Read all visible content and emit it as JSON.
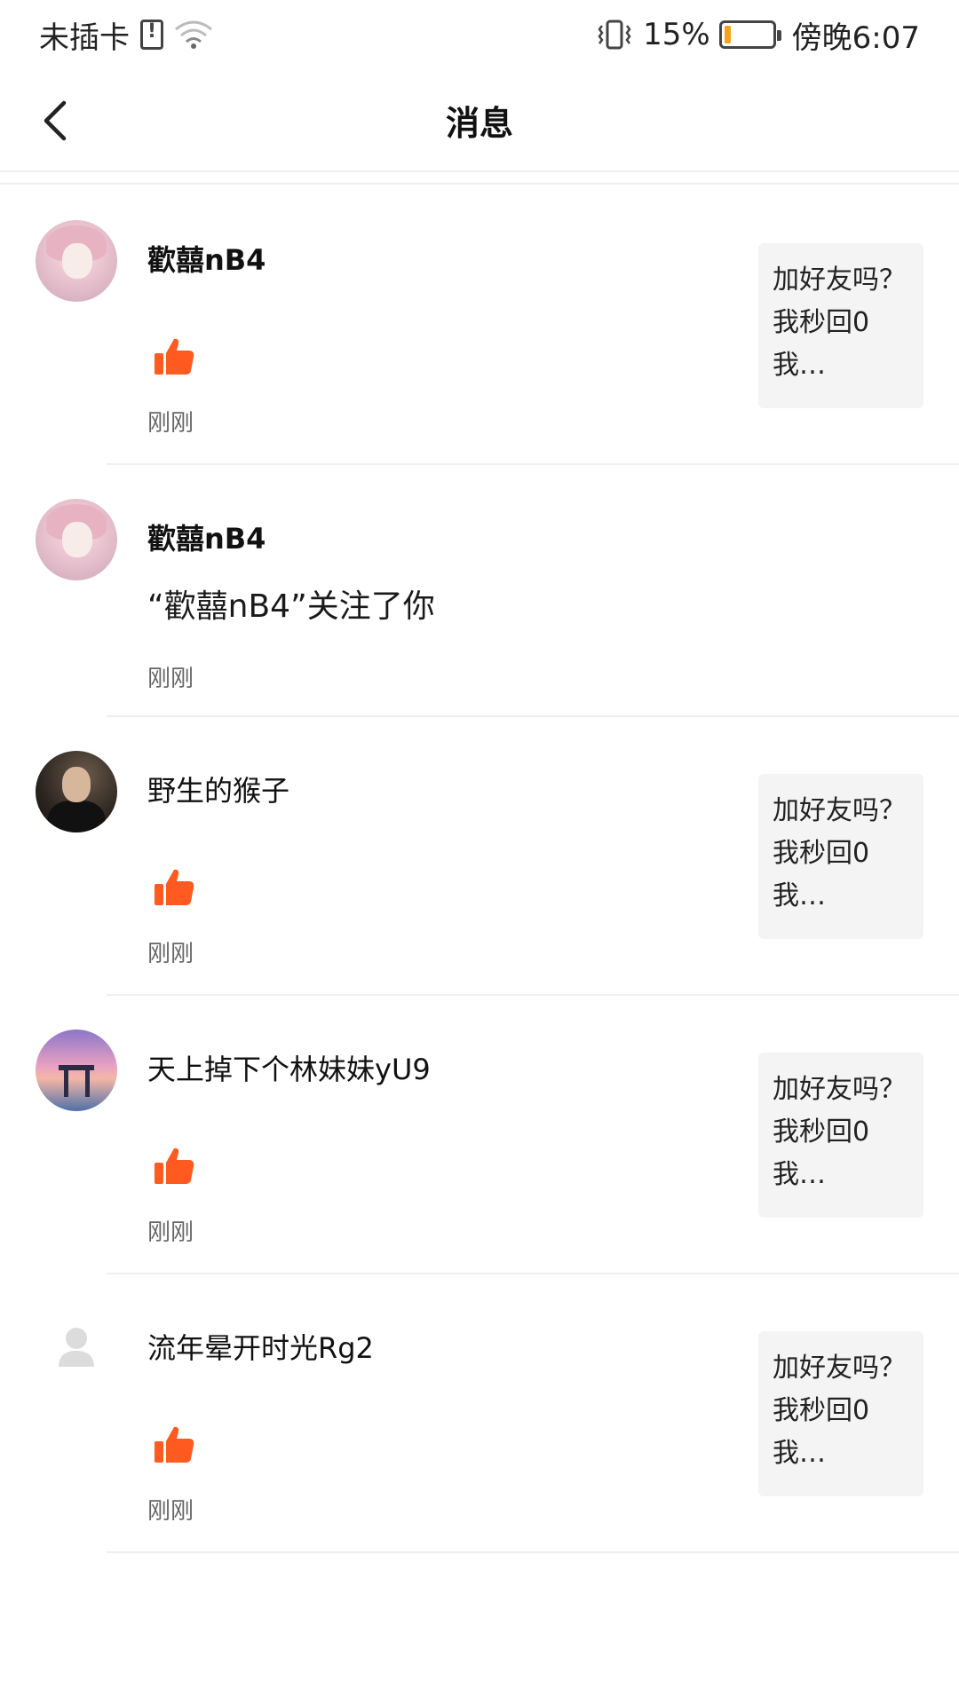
{
  "status_bar": {
    "carrier": "未插卡",
    "battery_percent": "15%",
    "battery_level": 0.15,
    "time": "傍晚6:07"
  },
  "header": {
    "title": "消息"
  },
  "messages": [
    {
      "name": "歡囍nB4",
      "type": "like",
      "time": "刚刚",
      "quote": "加好友吗？我秒回0  我…"
    },
    {
      "name": "歡囍nB4",
      "type": "follow",
      "text": "“歡囍nB4”关注了你",
      "time": "刚刚"
    },
    {
      "name": "野生的猴子",
      "type": "like",
      "time": "刚刚",
      "quote": "加好友吗？我秒回0  我…"
    },
    {
      "name": "天上掉下个林妹妹yU9",
      "type": "like",
      "time": "刚刚",
      "quote": "加好友吗？我秒回0  我…"
    },
    {
      "name": "流年晕开时光Rg2",
      "type": "like",
      "time": "刚刚",
      "quote": "加好友吗？我秒回0  我…"
    }
  ],
  "colors": {
    "like_orange": "#ff5a1f",
    "quote_bg": "#f4f4f4",
    "battery_fill": "#f2a31b"
  },
  "icons": {
    "back": "back-arrow-icon",
    "like": "thumbs-up-icon",
    "wifi": "wifi-icon",
    "sim": "sim-card-icon",
    "vibrate": "vibrate-icon",
    "battery": "battery-icon",
    "default_avatar": "default-user-icon"
  }
}
